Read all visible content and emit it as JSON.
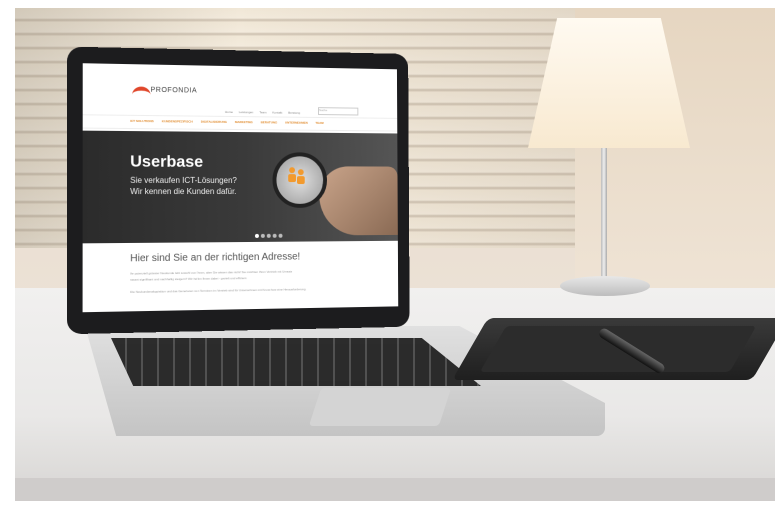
{
  "site": {
    "logo_text": "PROFONDIA",
    "top_nav": [
      "Home",
      "Leistungen",
      "Team",
      "Kontakt",
      "Beratung"
    ],
    "search_placeholder": "Suche",
    "menu_items": [
      "ICT SOLUTIONS",
      "KUNDENSPEZIFISCH",
      "DIGITALISIERUNG",
      "MARKETING",
      "BERATUNG",
      "UNTERNEHMEN",
      "TEAM"
    ],
    "hero": {
      "title": "Userbase",
      "subtitle_line1": "Sie verkaufen ICT-Lösungen?",
      "subtitle_line2": "Wir kennen die Kunden dafür."
    },
    "welcome_title": "Hier sind Sie an der richtigen Adresse!",
    "body_text_1": "Ihr potenziell grösster Neukunde lebt sowohl von Ihnen, aber Sie wissen das nicht! Sie möchten Ihren Vertrieb mit Umsatz",
    "body_text_2": "rasant signifikant und nachhaltig steigern? Wir helfen Ihnen dabei - gezielt und effizient.",
    "body_text_3": "Die Neukundenakquisition und das Generieren von Terminen im Vertrieb sind für Unternehmen mit Know-how eine Herausforderung."
  },
  "colors": {
    "accent": "#e0472b",
    "menu": "#e08a2c",
    "hero_bg": "#2b2b2b"
  }
}
